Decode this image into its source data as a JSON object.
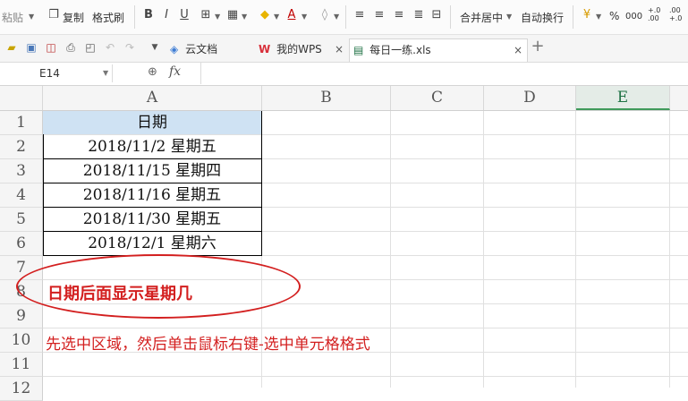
{
  "toolbar": {
    "paste": "粘贴",
    "copy": "复制",
    "format_painter": "格式刷",
    "bold": "B",
    "italic": "I",
    "underline": "U",
    "merge_center": "合并居中",
    "wrap_text": "自动换行",
    "percent": "%",
    "thousands": "000",
    "inc_decimal": "+.0 .00",
    "dec_decimal": ".00 +.0"
  },
  "tabs": [
    {
      "label": "云文档"
    },
    {
      "label": "我的WPS"
    },
    {
      "label": "每日一练.xls"
    }
  ],
  "formula_bar": {
    "cell_ref": "E14",
    "fx": "fx",
    "value": ""
  },
  "columns": [
    "A",
    "B",
    "C",
    "D",
    "E"
  ],
  "selected_column": "E",
  "rows": [
    "1",
    "2",
    "3",
    "4",
    "5",
    "6",
    "7",
    "8",
    "9",
    "10",
    "11",
    "12"
  ],
  "table": {
    "header": "日期",
    "values": [
      "2018/11/2 星期五",
      "2018/11/15 星期四",
      "2018/11/16 星期五",
      "2018/11/30 星期五",
      "2018/12/1 星期六"
    ]
  },
  "annotations": {
    "circled_note": "日期后面显示星期几",
    "instruction": "先选中区域，然后单击鼠标右键-选中单元格格式"
  },
  "colors": {
    "header_fill": "#cfe2f3",
    "annotation_red": "#d31f1f",
    "selected_column": "#217346"
  }
}
